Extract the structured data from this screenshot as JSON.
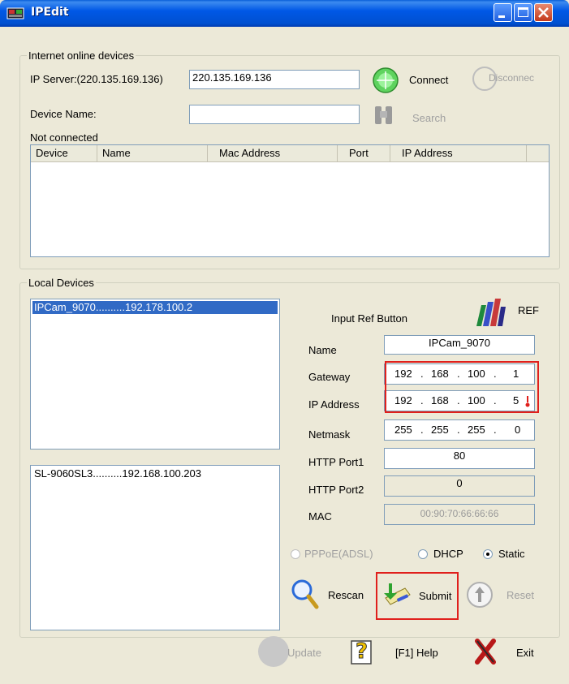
{
  "window": {
    "title": "IPEdit"
  },
  "online": {
    "group_label": "Internet online devices",
    "ip_server_label": "IP Server:(220.135.169.136)",
    "ip_server_value": "220.135.169.136",
    "connect_label": "Connect",
    "disconnect_label": "Disconnec",
    "device_name_label": "Device Name:",
    "device_name_value": "",
    "search_label": "Search",
    "status": "Not connected",
    "columns": [
      "Device",
      "Name",
      "Mac Address",
      "Port",
      "IP Address"
    ]
  },
  "local": {
    "group_label": "Local Devices",
    "list1": [
      "IPCam_9070..........192.178.100.2"
    ],
    "list2": [
      "SL-9060SL3..........192.168.100.203"
    ],
    "input_ref_label": "Input Ref Button",
    "ref_label": "REF",
    "name_label": "Name",
    "name_value": "IPCam_9070",
    "gateway_label": "Gateway",
    "gateway": [
      "192",
      "168",
      "100",
      "1"
    ],
    "ip_label": "IP Address",
    "ip": [
      "192",
      "168",
      "100",
      "5"
    ],
    "netmask_label": "Netmask",
    "netmask": [
      "255",
      "255",
      "255",
      "0"
    ],
    "http1_label": "HTTP Port1",
    "http1_value": "80",
    "http2_label": "HTTP Port2",
    "http2_value": "0",
    "mac_label": "MAC",
    "mac_value": "00:90:70:66:66:66",
    "radio_pppoe": "PPPoE(ADSL)",
    "radio_dhcp": "DHCP",
    "radio_static": "Static",
    "selected_mode": "Static",
    "rescan_label": "Rescan",
    "submit_label": "Submit",
    "reset_label": "Reset"
  },
  "footer": {
    "update_label": "Update",
    "help_label": "[F1] Help",
    "exit_label": "Exit"
  },
  "colors": {
    "highlight_red": "#e0201c",
    "selection_blue": "#316ac5",
    "title_blue": "#0058e6"
  }
}
